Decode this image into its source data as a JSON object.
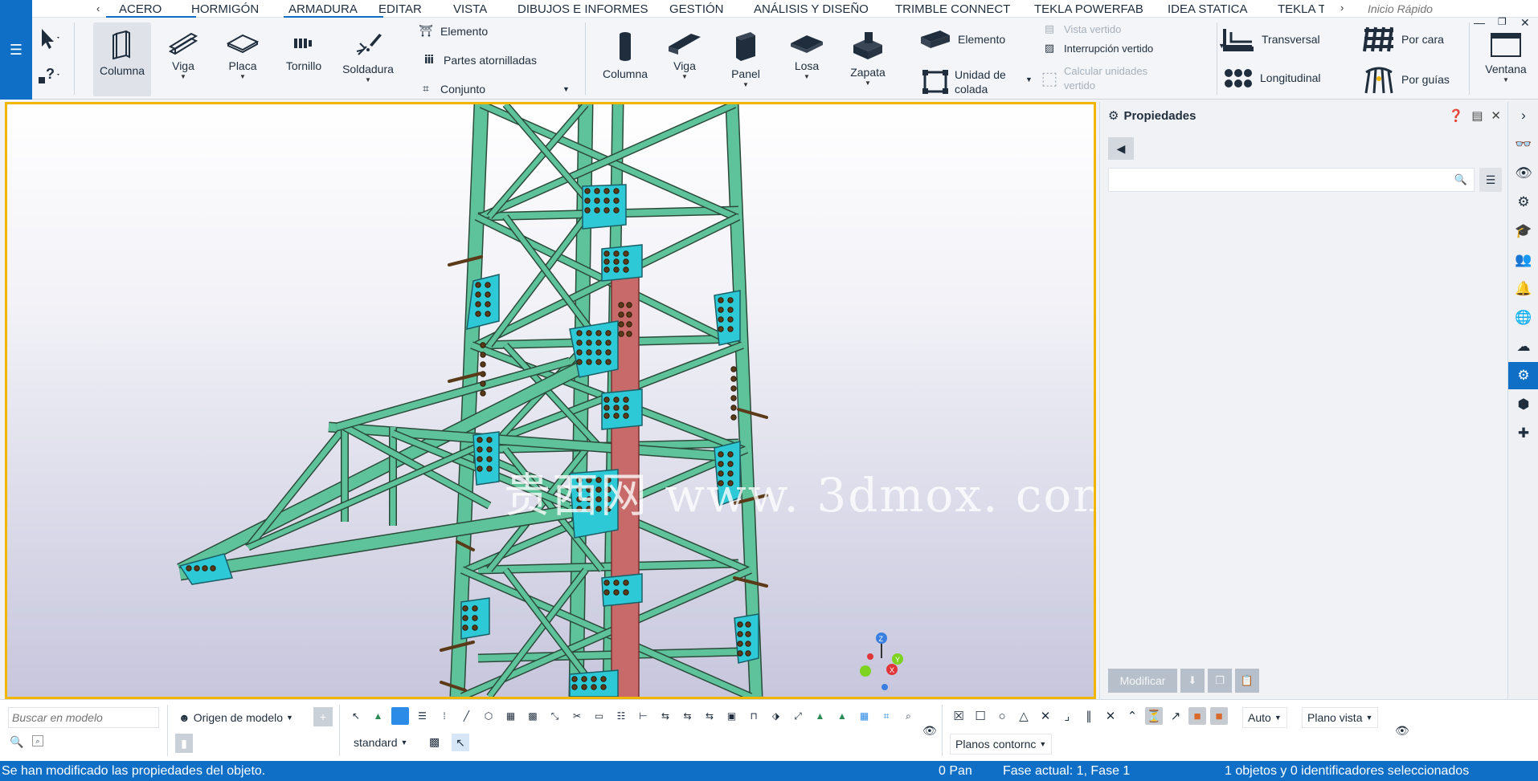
{
  "menu": {
    "prev_icon": "chevron-left-icon",
    "tabs": [
      "ACERO",
      "HORMIGÓN",
      "ARMADURA",
      "EDITAR",
      "VISTA",
      "DIBUJOS E INFORMES",
      "GESTIÓN",
      "ANÁLISIS Y DISEÑO",
      "TRIMBLE CONNECT",
      "TEKLA POWERFAB",
      "IDEA STATICA",
      "TEKLA T"
    ],
    "active_tab": "ACERO",
    "next_icon": "chevron-right-icon",
    "quick_launch_placeholder": "Inicio Rápido"
  },
  "ribbon": {
    "steel": {
      "column": "Columna",
      "beam": "Viga",
      "plate": "Placa",
      "bolt": "Tornillo",
      "weld": "Soldadura",
      "part": "Elemento",
      "bolted_parts": "Partes atornilladas",
      "assembly": "Conjunto"
    },
    "concrete": {
      "column": "Columna",
      "beam": "Viga",
      "panel": "Panel",
      "slab": "Losa",
      "footing": "Zapata",
      "part": "Elemento",
      "pour_unit_line1": "Unidad de",
      "pour_unit_line2": "colada",
      "pour_view": "Vista vertido",
      "pour_break": "Interrupción vertido",
      "calc_pour_line1": "Calcular unidades",
      "calc_pour_line2": "vertido"
    },
    "rebar": {
      "transverse": "Transversal",
      "longitudinal": "Longitudinal",
      "by_face": "Por cara",
      "by_guides": "Por guías"
    },
    "window": "Ventana"
  },
  "viewport": {
    "watermark": "贵西网 www. 3dmox. com",
    "frame_color": "#f2b500",
    "steel_color": "#5ec39a",
    "plate_color": "#2ec9d6",
    "column_color": "#c86a6a"
  },
  "properties": {
    "title": "Propiedades",
    "help_icon": "help-icon",
    "layout_icon": "layout-icon",
    "close_icon": "close-icon",
    "back_icon": "back-arrow-icon",
    "search_icon": "search-icon",
    "menu_icon": "list-menu-icon",
    "modify_label": "Modificar"
  },
  "sidebar": {
    "icons": [
      "collapse-chevron-icon",
      "glasses-icon",
      "view-eye-icon",
      "help-settings-icon",
      "learning-cap-icon",
      "users-icon",
      "notification-bell-icon",
      "globe-icon",
      "cloud-icon",
      "settings-gear-icon",
      "cube-icon",
      "add-components-icon"
    ],
    "active": "settings-gear-icon"
  },
  "bottom": {
    "search_placeholder": "Buscar en modelo",
    "origin_label": "Origen de modelo",
    "standard_label": "standard",
    "auto_label": "Auto",
    "view_plane_label": "Plano vista",
    "contour_planes_label": "Planos contornc"
  },
  "status": {
    "message": "Se han modificado las propiedades del objeto.",
    "pan": "0  Pan",
    "phase": "Fase actual: 1, Fase 1",
    "selection": "1 objetos y 0 identificadores seleccionados"
  },
  "colors": {
    "accent": "#0f6fc6",
    "status_bar": "#0f6fc6",
    "frame": "#f2b500"
  }
}
